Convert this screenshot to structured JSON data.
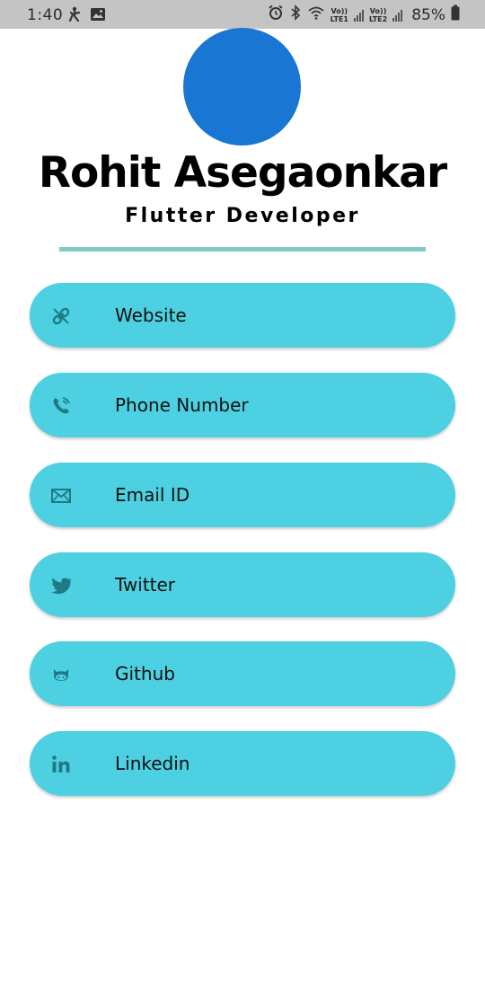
{
  "status_bar": {
    "time": "1:40",
    "battery": "85%",
    "sim1": "LTE1",
    "sim2": "LTE2",
    "volte": "Vo))",
    "icons": [
      "accessibility-icon",
      "image-icon",
      "alarm-icon",
      "bluetooth-icon",
      "wifi-icon",
      "signal-icon",
      "battery-icon"
    ]
  },
  "profile": {
    "name": "Rohit Asegaonkar",
    "title": "Flutter Developer",
    "avatar_color": "#1976d2"
  },
  "colors": {
    "card": "#4dd0e1",
    "icon": "#1f7a86",
    "divider": "#80cbc4"
  },
  "cards": [
    {
      "label": "Website",
      "icon": "link-icon"
    },
    {
      "label": "Phone Number",
      "icon": "phone-icon"
    },
    {
      "label": "Email ID",
      "icon": "mail-icon"
    },
    {
      "label": "Twitter",
      "icon": "twitter-icon"
    },
    {
      "label": "Github",
      "icon": "github-icon"
    },
    {
      "label": "Linkedin",
      "icon": "linkedin-icon"
    }
  ]
}
